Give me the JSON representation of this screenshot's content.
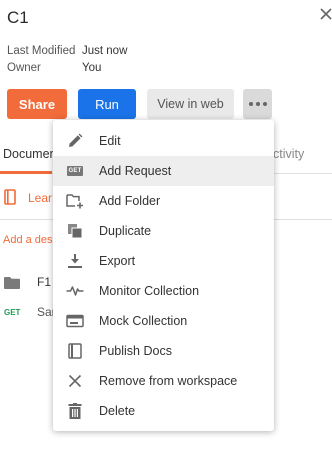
{
  "collection": {
    "title": "C1"
  },
  "meta": {
    "last_modified_label": "Last Modified",
    "last_modified_value": "Just now",
    "owner_label": "Owner",
    "owner_value": "You"
  },
  "actions": {
    "share_label": "Share",
    "run_label": "Run",
    "view_in_web_label": "View in web"
  },
  "tabs": {
    "documentation_label": "Documen",
    "activity_label": "ctivity"
  },
  "learn_banner": {
    "label": "Lear"
  },
  "description": {
    "add_label": "Add a desc"
  },
  "tree": {
    "folder_name": "F1",
    "request_method": "GET",
    "request_name": "Sam"
  },
  "menu": {
    "items": [
      {
        "label": "Edit",
        "icon": "pencil-icon"
      },
      {
        "label": "Add Request",
        "icon": "get-request-icon",
        "badge": "GET"
      },
      {
        "label": "Add Folder",
        "icon": "add-folder-icon"
      },
      {
        "label": "Duplicate",
        "icon": "duplicate-icon"
      },
      {
        "label": "Export",
        "icon": "export-icon"
      },
      {
        "label": "Monitor Collection",
        "icon": "monitor-icon"
      },
      {
        "label": "Mock Collection",
        "icon": "mock-icon"
      },
      {
        "label": "Publish Docs",
        "icon": "publish-docs-icon"
      },
      {
        "label": "Remove from workspace",
        "icon": "remove-icon"
      },
      {
        "label": "Delete",
        "icon": "trash-icon"
      }
    ],
    "highlighted_index": 1
  },
  "colors": {
    "accent": "#f26b3a",
    "primary": "#1a73e8",
    "get_method": "#1f9d55",
    "menu_hover": "#eeeeee"
  }
}
